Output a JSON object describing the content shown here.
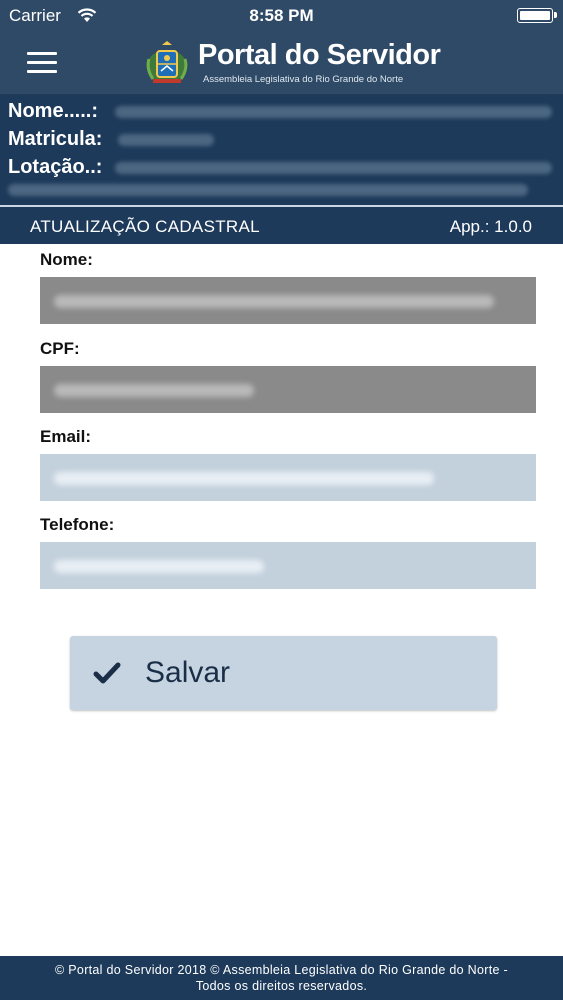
{
  "status_bar": {
    "carrier": "Carrier",
    "time": "8:58 PM",
    "wifi_icon": "wifi-icon",
    "battery_icon": "battery-icon"
  },
  "header": {
    "menu_icon": "hamburger-menu-icon",
    "title": "Portal do Servidor",
    "subtitle": "Assembleia Legislativa do Rio Grande do Norte",
    "logo_icon": "crest-icon",
    "background_color": "#2f4a66"
  },
  "user_info": {
    "nome_label": "Nome.....:",
    "matricula_label": "Matricula:",
    "lotacao_label": "Lotação..:",
    "background_color": "#1d3a5a"
  },
  "section": {
    "title": "ATUALIZAÇÃO CADASTRAL",
    "app_version": "App.: 1.0.0"
  },
  "form": {
    "nome_label": "Nome:",
    "cpf_label": "CPF:",
    "email_label": "Email:",
    "telefone_label": "Telefone:",
    "readonly_field_color": "#8a8a8a",
    "editable_field_color": "#c3d1dd"
  },
  "save_button": {
    "label": "Salvar",
    "icon": "checkmark-icon"
  },
  "footer": {
    "line1": "© Portal do Servidor 2018 © Assembleia Legislativa do Rio Grande do Norte -",
    "line2": "Todos os direitos reservados."
  }
}
